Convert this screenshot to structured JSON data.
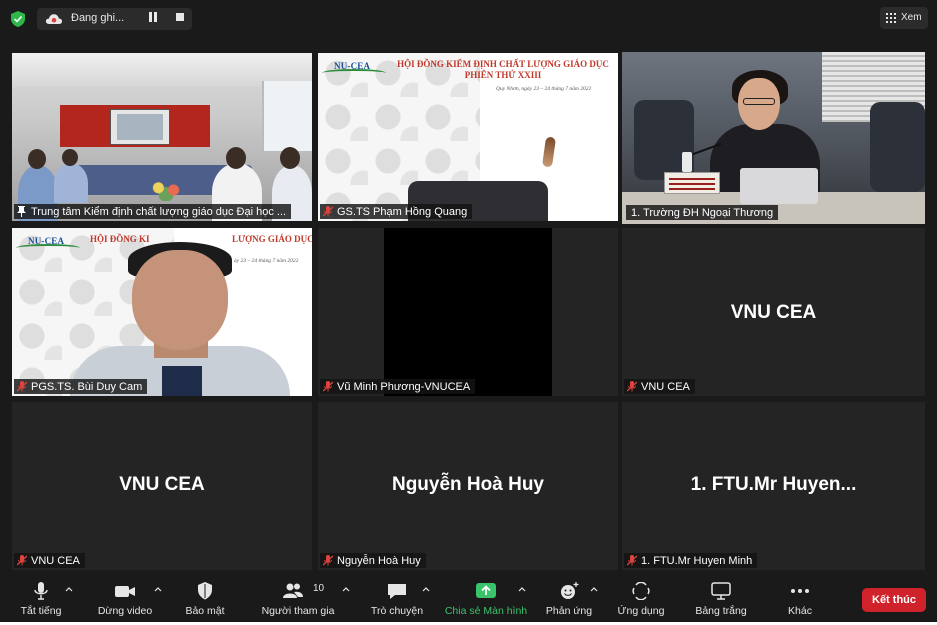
{
  "recording": {
    "label": "Đang ghi..."
  },
  "view": {
    "label": "Xem"
  },
  "tiles": [
    {
      "name": "Trung tâm Kiểm định chất lượng giáo dục Đại học ..."
    },
    {
      "name": "GS.TS Phạm Hồng Quang"
    },
    {
      "name": "1. Trường ĐH Ngoại Thương"
    },
    {
      "name": "PGS.TS. Bùi Duy Cam"
    },
    {
      "name": "Vũ Minh Phương-VNUCEA"
    },
    {
      "name": "VNU CEA",
      "display": "VNU CEA"
    },
    {
      "name": "VNU CEA",
      "display": "VNU CEA"
    },
    {
      "name": "Nguyễn Hoà Huy",
      "display": "Nguyễn Hoà Huy"
    },
    {
      "name": "1. FTU.Mr Huyen Minh",
      "display": "1. FTU.Mr Huyen..."
    }
  ],
  "slide": {
    "logo": "NU-CEA",
    "title_line1": "HỘI ĐỒNG KIỂM ĐỊNH CHẤT LƯỢNG GIÁO DỤC",
    "title_line2": "PHIÊN THỨ XXIII",
    "date": "Quy Nhơn, ngày 23 – 24 tháng 7 năm 2022"
  },
  "slide_partial": {
    "logo": "NU-CEA",
    "title_left": "HỘI ĐỒNG KI",
    "title_right": "LƯỢNG GIÁO DỤC",
    "date": "ày 23 – 24 tháng 7 năm 2022"
  },
  "toolbar": {
    "mute": "Tắt tiếng",
    "video": "Dừng video",
    "security": "Bảo mật",
    "participants": "Người tham gia",
    "participants_count": "10",
    "chat": "Trò chuyện",
    "share": "Chia sẻ Màn hình",
    "reactions": "Phản ứng",
    "apps": "Ứng dụng",
    "whiteboard": "Bảng trắng",
    "more": "Khác",
    "end": "Kết thúc"
  },
  "colors": {
    "background": "#1a1a1a",
    "tile": "#242424",
    "active_speaker_border": "#cfe26a",
    "share_green": "#3ac36b",
    "end_red": "#d0222a",
    "muted_red": "#e0433b"
  }
}
